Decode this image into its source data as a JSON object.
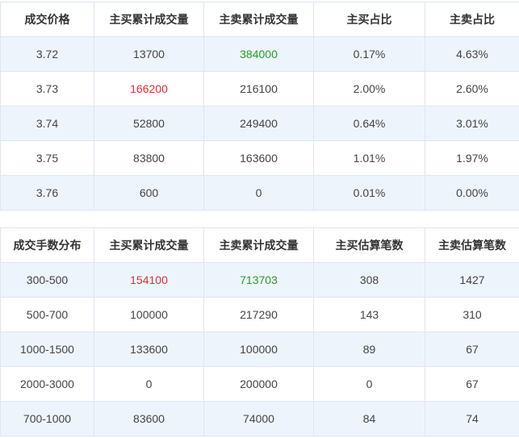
{
  "price_table": {
    "headers": [
      "成交价格",
      "主买累计成交量",
      "主卖累计成交量",
      "主买占比",
      "主卖占比"
    ],
    "rows": [
      [
        "3.72",
        "13700",
        "384000",
        "0.17%",
        "4.63%"
      ],
      [
        "3.73",
        "166200",
        "216100",
        "2.00%",
        "2.60%"
      ],
      [
        "3.74",
        "52800",
        "249400",
        "0.64%",
        "3.01%"
      ],
      [
        "3.75",
        "83800",
        "163600",
        "1.01%",
        "1.97%"
      ],
      [
        "3.76",
        "600",
        "0",
        "0.01%",
        "0.00%"
      ]
    ]
  },
  "lot_table": {
    "headers": [
      "成交手数分布",
      "主买累计成交量",
      "主卖累计成交量",
      "主买估算笔数",
      "主卖估算笔数"
    ],
    "rows": [
      [
        "300-500",
        "154100",
        "713703",
        "308",
        "1427"
      ],
      [
        "500-700",
        "100000",
        "217290",
        "143",
        "310"
      ],
      [
        "1000-1500",
        "133600",
        "100000",
        "89",
        "67"
      ],
      [
        "2000-3000",
        "0",
        "200000",
        "0",
        "67"
      ],
      [
        "700-1000",
        "83600",
        "74000",
        "84",
        "74"
      ]
    ]
  },
  "colors": {
    "highlight_red": "#e03030",
    "highlight_green": "#23a023",
    "row_stripe": "#eef4fc"
  }
}
